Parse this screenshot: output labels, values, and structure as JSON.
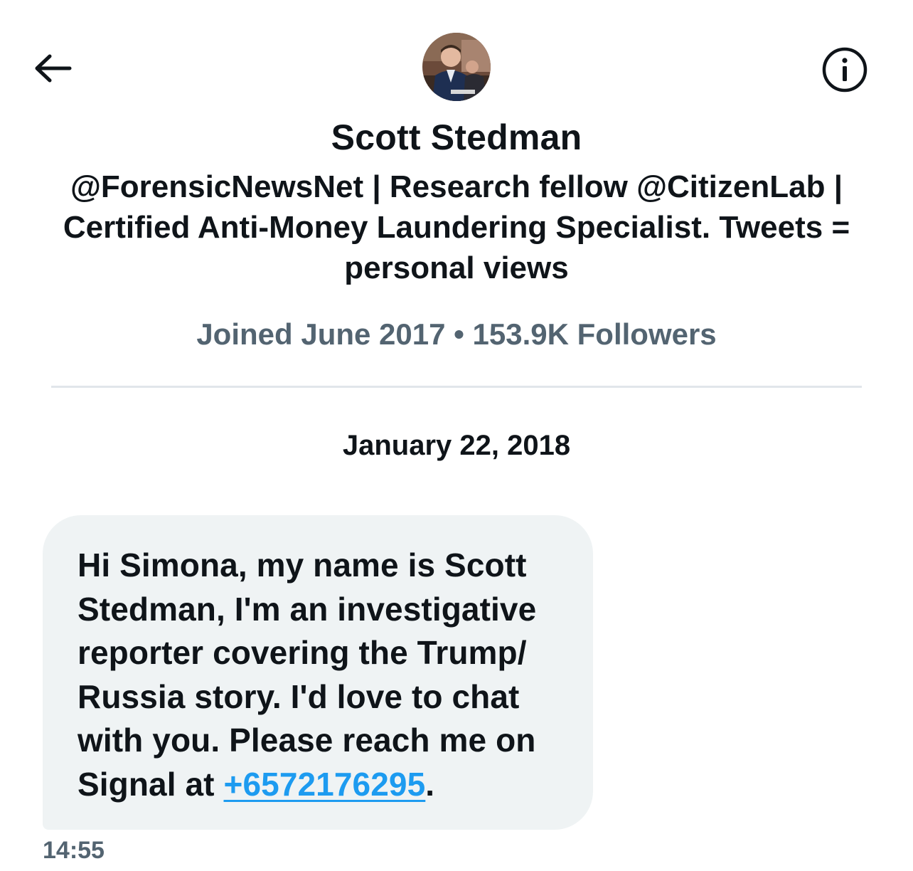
{
  "header": {
    "back_icon": "arrow-left-icon",
    "info_icon": "info-circle-icon",
    "avatar_alt": "profile photo"
  },
  "profile": {
    "name": "Scott Stedman",
    "bio": "@ForensicNewsNet | Research fellow @CitizenLab | Certified Anti-Money Laundering Specialist. Tweets = personal views",
    "joined": "Joined June 2017",
    "separator": "•",
    "followers": "153.9K Followers"
  },
  "conversation": {
    "date": "January 22, 2018",
    "messages": [
      {
        "text_before": "Hi Simona, my name is Scott Stedman, I'm an investigative reporter covering the Trump/​Russia story. I'd love to chat with you. Please reach me on Signal at ",
        "link": "+6572176295",
        "text_after": ".",
        "time": "14:55"
      }
    ]
  },
  "colors": {
    "text_primary": "#0f1419",
    "text_secondary": "#536471",
    "bubble_bg": "#eff3f4",
    "link": "#1d9bf0",
    "divider": "#e1e6ea"
  }
}
